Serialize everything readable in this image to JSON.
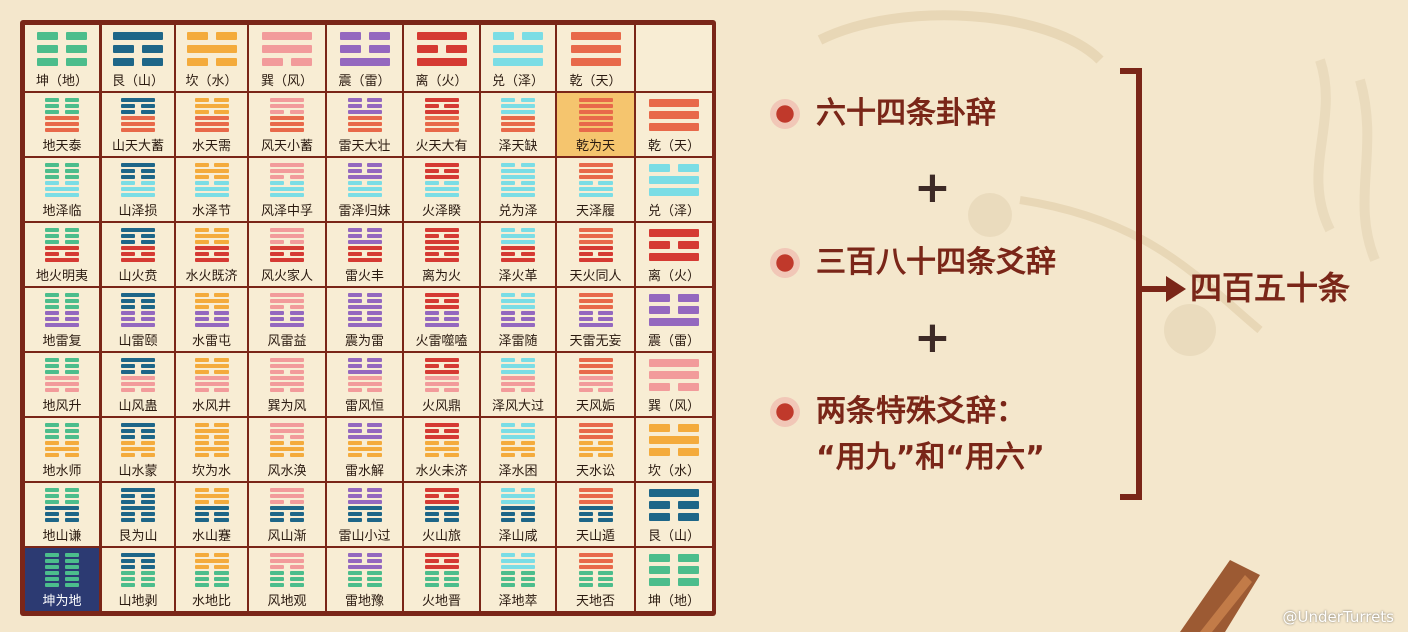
{
  "colors": {
    "kun": "#4cbd8c",
    "gen": "#1e6688",
    "kan": "#f4ab3c",
    "xun": "#f29b9b",
    "zhen": "#9468bf",
    "li": "#d53a33",
    "dui": "#7bdde5",
    "qian": "#e8694a",
    "accent": "#7a2618",
    "bullet": "#c0392b",
    "highlight_gold": "#f5c56e",
    "highlight_navy": "#2c3a72"
  },
  "trigrams": {
    "kun": {
      "lines": [
        0,
        0,
        0
      ],
      "color_key": "kun"
    },
    "gen": {
      "lines": [
        1,
        0,
        0
      ],
      "color_key": "gen"
    },
    "kan": {
      "lines": [
        0,
        1,
        0
      ],
      "color_key": "kan"
    },
    "xun": {
      "lines": [
        1,
        1,
        0
      ],
      "color_key": "xun"
    },
    "zhen": {
      "lines": [
        0,
        0,
        1
      ],
      "color_key": "zhen"
    },
    "li": {
      "lines": [
        1,
        0,
        1
      ],
      "color_key": "li"
    },
    "dui": {
      "lines": [
        0,
        1,
        1
      ],
      "color_key": "dui"
    },
    "qian": {
      "lines": [
        1,
        1,
        1
      ],
      "color_key": "qian"
    }
  },
  "header_trigrams": [
    {
      "key": "kun",
      "label": "坤（地）"
    },
    {
      "key": "gen",
      "label": "艮（山）"
    },
    {
      "key": "kan",
      "label": "坎（水）"
    },
    {
      "key": "xun",
      "label": "巽（风）"
    },
    {
      "key": "zhen",
      "label": "震（雷）"
    },
    {
      "key": "li",
      "label": "离（火）"
    },
    {
      "key": "dui",
      "label": "兑（泽）"
    },
    {
      "key": "qian",
      "label": "乾（天）"
    }
  ],
  "row_trigrams": [
    {
      "key": "qian",
      "label": "乾（天）"
    },
    {
      "key": "dui",
      "label": "兑（泽）"
    },
    {
      "key": "li",
      "label": "离（火）"
    },
    {
      "key": "zhen",
      "label": "震（雷）"
    },
    {
      "key": "xun",
      "label": "巽（风）"
    },
    {
      "key": "kan",
      "label": "坎（水）"
    },
    {
      "key": "gen",
      "label": "艮（山）"
    },
    {
      "key": "kun",
      "label": "坤（地）"
    }
  ],
  "hexagram_names": [
    [
      "地天泰",
      "山天大蓄",
      "水天需",
      "风天小蓄",
      "雷天大壮",
      "火天大有",
      "泽天缺",
      "乾为天"
    ],
    [
      "地泽临",
      "山泽损",
      "水泽节",
      "风泽中孚",
      "雷泽归妹",
      "火泽睽",
      "兑为泽",
      "天泽履"
    ],
    [
      "地火明夷",
      "山火贲",
      "水火既济",
      "风火家人",
      "雷火丰",
      "离为火",
      "泽火革",
      "天火同人"
    ],
    [
      "地雷复",
      "山雷颐",
      "水雷屯",
      "风雷益",
      "震为雷",
      "火雷噬嗑",
      "泽雷随",
      "天雷无妄"
    ],
    [
      "地风升",
      "山风蛊",
      "水风井",
      "巽为风",
      "雷风恒",
      "火风鼎",
      "泽风大过",
      "天风姤"
    ],
    [
      "地水师",
      "山水蒙",
      "坎为水",
      "风水涣",
      "雷水解",
      "水火未济",
      "泽水困",
      "天水讼"
    ],
    [
      "地山谦",
      "艮为山",
      "水山蹇",
      "风山渐",
      "雷山小过",
      "火山旅",
      "泽山咸",
      "天山遁"
    ],
    [
      "坤为地",
      "山地剥",
      "水地比",
      "风地观",
      "雷地豫",
      "火地晋",
      "泽地萃",
      "天地否"
    ]
  ],
  "highlights": [
    {
      "row": 0,
      "col": 7,
      "style": "gold"
    },
    {
      "row": 7,
      "col": 0,
      "style": "navy"
    }
  ],
  "summary": {
    "item1": "六十四条卦辞",
    "item2": "三百八十四条爻辞",
    "item3_line1": "两条特殊爻辞：",
    "item3_line2": "“用九”和“用六”",
    "plus": "+",
    "result": "四百五十条"
  },
  "watermark": "@UnderTurrets"
}
